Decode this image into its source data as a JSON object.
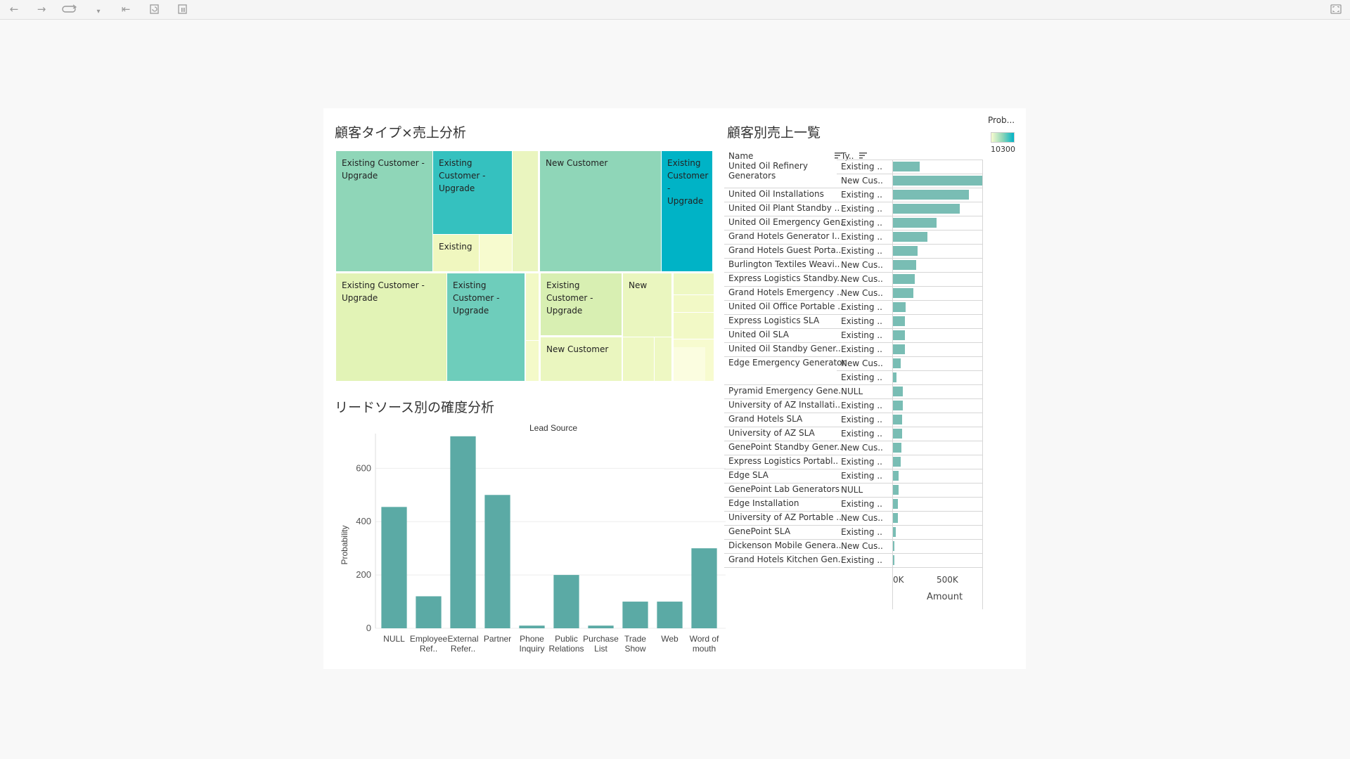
{
  "toolbar": {
    "icons": [
      "back-arrow-icon",
      "forward-arrow-icon",
      "redo-icon",
      "dropdown-icon",
      "first-page-icon",
      "refresh-icon",
      "pause-icon",
      "fullscreen-icon"
    ]
  },
  "colors": {
    "bar": "#5baaa5",
    "table_bar": "#79bdb4",
    "treemap_light": "#f7fbcf",
    "treemap_mid": "#8fd6b8",
    "treemap_dark": "#00b3c6"
  },
  "treemap": {
    "title": "顧客タイプ×売上分析",
    "cells": [
      {
        "label": "Existing Customer - Upgrade",
        "color": "#8fd6b8"
      },
      {
        "label": "Existing Customer - Upgrade",
        "color": "#35c1bf"
      },
      {
        "label": "Existing",
        "color": "#f0f7bf"
      },
      {
        "label": "",
        "color": "#f7fbcf"
      },
      {
        "label": "",
        "color": "#eaf5bf"
      },
      {
        "label": "New Customer",
        "color": "#8fd6b8"
      },
      {
        "label": "Existing Customer - Upgrade",
        "color": "#00b3c6"
      },
      {
        "label": "Existing Customer - Upgrade",
        "color": "#e2f3b6"
      },
      {
        "label": "Existing Customer - Upgrade",
        "color": "#6ecdbb"
      },
      {
        "label": "",
        "color": "#f2f9c6"
      },
      {
        "label": "",
        "color": "#f4fac9"
      },
      {
        "label": "Existing Customer - Upgrade",
        "color": "#d8efb2"
      },
      {
        "label": "New",
        "color": "#eaf6bf"
      },
      {
        "label": "New Customer",
        "color": "#eaf6bf"
      },
      {
        "label": "",
        "color": "#eef8c3"
      },
      {
        "label": "",
        "color": "#eef8c3"
      },
      {
        "label": "",
        "color": "#eef8c3"
      },
      {
        "label": "",
        "color": "#f2f9c6"
      },
      {
        "label": "",
        "color": "#f2f9c6"
      },
      {
        "label": "",
        "color": "#f7fbcf"
      },
      {
        "label": "",
        "color": "#fbfde0"
      }
    ]
  },
  "table": {
    "title": "顧客別売上一覧",
    "col_name": "Name",
    "col_type": "Ty..",
    "axis_title": "Amount",
    "axis_ticks": [
      "0K",
      "500K"
    ],
    "axis_max": 1000000,
    "rows": [
      {
        "name": "United Oil Refinery",
        "name2": "Generators",
        "type": "Existing ..",
        "amount": 270000
      },
      {
        "name": "",
        "name2": "",
        "type": "New Cus..",
        "amount": 915000
      },
      {
        "name": "United Oil Installations",
        "name2": "",
        "type": "Existing ..",
        "amount": 770000
      },
      {
        "name": "United Oil Plant Standby ..",
        "name2": "",
        "type": "Existing ..",
        "amount": 675000
      },
      {
        "name": "United Oil Emergency Gen..",
        "name2": "",
        "type": "Existing ..",
        "amount": 440000
      },
      {
        "name": "Grand Hotels Generator I..",
        "name2": "",
        "type": "Existing ..",
        "amount": 350000
      },
      {
        "name": "Grand Hotels Guest Porta..",
        "name2": "",
        "type": "Existing ..",
        "amount": 250000
      },
      {
        "name": "Burlington Textiles Weavi..",
        "name2": "",
        "type": "New Cus..",
        "amount": 235000
      },
      {
        "name": "Express Logistics Standby..",
        "name2": "",
        "type": "New Cus..",
        "amount": 220000
      },
      {
        "name": "Grand Hotels Emergency ..",
        "name2": "",
        "type": "New Cus..",
        "amount": 210000
      },
      {
        "name": "United Oil Office Portable ..",
        "name2": "",
        "type": "Existing ..",
        "amount": 125000
      },
      {
        "name": "Express Logistics SLA",
        "name2": "",
        "type": "Existing ..",
        "amount": 120000
      },
      {
        "name": "United Oil SLA",
        "name2": "",
        "type": "Existing ..",
        "amount": 120000
      },
      {
        "name": "United Oil Standby Gener..",
        "name2": "",
        "type": "Existing ..",
        "amount": 120000
      },
      {
        "name": "Edge Emergency Generator",
        "name2": "",
        "type": "New Cus..",
        "amount": 75000
      },
      {
        "name": "",
        "name2": "",
        "type": "Existing ..",
        "amount": 35000
      },
      {
        "name": "Pyramid Emergency Gene..",
        "name2": "",
        "type": "NULL",
        "amount": 100000
      },
      {
        "name": "University of AZ Installati..",
        "name2": "",
        "type": "Existing ..",
        "amount": 100000
      },
      {
        "name": "Grand Hotels SLA",
        "name2": "",
        "type": "Existing ..",
        "amount": 90000
      },
      {
        "name": "University of AZ SLA",
        "name2": "",
        "type": "Existing ..",
        "amount": 90000
      },
      {
        "name": "GenePoint Standby Gener..",
        "name2": "",
        "type": "New Cus..",
        "amount": 85000
      },
      {
        "name": "Express Logistics Portabl..",
        "name2": "",
        "type": "Existing ..",
        "amount": 80000
      },
      {
        "name": "Edge SLA",
        "name2": "",
        "type": "Existing ..",
        "amount": 60000
      },
      {
        "name": "GenePoint Lab Generators",
        "name2": "",
        "type": "NULL",
        "amount": 60000
      },
      {
        "name": "Edge Installation",
        "name2": "",
        "type": "Existing ..",
        "amount": 50000
      },
      {
        "name": "University of AZ Portable ..",
        "name2": "",
        "type": "New Cus..",
        "amount": 50000
      },
      {
        "name": "GenePoint SLA",
        "name2": "",
        "type": "Existing ..",
        "amount": 30000
      },
      {
        "name": "Dickenson Mobile Genera..",
        "name2": "",
        "type": "New Cus..",
        "amount": 15000
      },
      {
        "name": "Grand Hotels Kitchen Gen..",
        "name2": "",
        "type": "Existing ..",
        "amount": 15000
      }
    ]
  },
  "legend": {
    "title": "Prob...",
    "value": "10300"
  },
  "chart_data": {
    "type": "bar",
    "title": "リードソース別の確度分析",
    "top_label": "Lead Source",
    "xlabel": "",
    "ylabel": "Probability",
    "ylim": [
      0,
      730
    ],
    "yticks": [
      0,
      200,
      400,
      600
    ],
    "categories": [
      [
        "NULL"
      ],
      [
        "Employee",
        "Ref.."
      ],
      [
        "External",
        "Refer.."
      ],
      [
        "Partner"
      ],
      [
        "Phone",
        "Inquiry"
      ],
      [
        "Public",
        "Relations"
      ],
      [
        "Purchase",
        "List"
      ],
      [
        "Trade",
        "Show"
      ],
      [
        "Web"
      ],
      [
        "Word of",
        "mouth"
      ]
    ],
    "values": [
      455,
      120,
      720,
      500,
      10,
      200,
      10,
      100,
      100,
      300
    ],
    "grid": true
  }
}
